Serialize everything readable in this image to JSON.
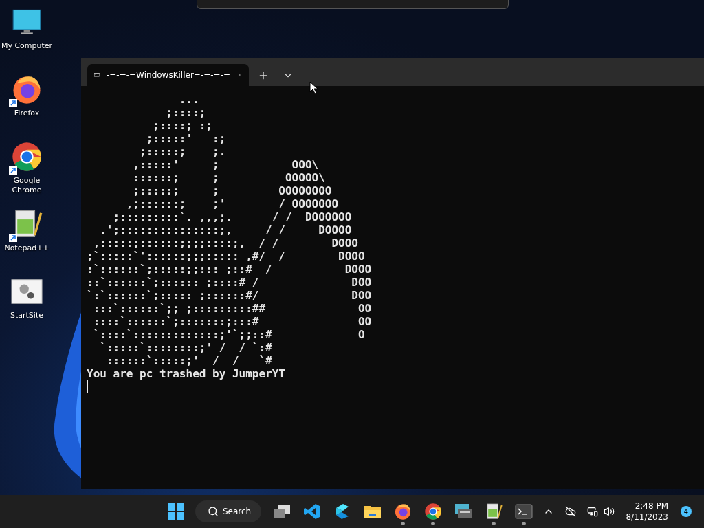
{
  "desktop_icons": [
    {
      "label": "My Computer",
      "kind": "monitor",
      "shortcut": false
    },
    {
      "label": "Firefox",
      "kind": "firefox",
      "shortcut": true
    },
    {
      "label": "Google Chrome",
      "kind": "chrome",
      "shortcut": true
    },
    {
      "label": "Notepad++",
      "kind": "notepad",
      "shortcut": true
    },
    {
      "label": "StartSite",
      "kind": "gears",
      "shortcut": false
    }
  ],
  "terminal": {
    "tabs": [
      {
        "title": "-=-=-=WindowsKiller=-=-=-=",
        "selected": true
      }
    ],
    "lines": [
      "              ...",
      "            ;::::;",
      "          ;::::; :;",
      "         ;:::::'   :;",
      "        ;:::::;    ;.",
      "       ,:::::'     ;           OOO\\",
      "       ::::::;     ;          OOOOO\\",
      "       ;:::::;     ;         OOOOOOOO",
      "      ,;::::::;    ;'        / OOOOOOO",
      "    ;:::::::::`. ,,,;.      / /  DOOOOOO",
      "  .';:::::::::::::::;,     / /     DOOOO",
      " ,:::::;::::::;;;;::::;,  / /        DOOO",
      ";`:::::`'::::::;;;::::: ,#/  /        DOOO",
      ":`::::::`;:::::;;::: ;::#  /           DOOO",
      "::`::::::`;:::::: ;::::# /              DOO",
      "`:`::::::`;::::: ;::::::#/              DOO",
      " :::`::::::`;; ;:::::::::##              OO",
      " ::::`::::::`;:::::::;:::#               OO",
      " `::::`:::::::::::::;'`;;::#             O",
      "  `:::::`::::::::;' /  / `:#",
      "   ::::::`:::::;'  /  /   `#",
      "You are pc trashed by JumperYT"
    ]
  },
  "taskbar": {
    "search": {
      "placeholder": "Search"
    },
    "apps": [
      {
        "kind": "taskview",
        "running": false
      },
      {
        "kind": "vscode",
        "running": false
      },
      {
        "kind": "azure",
        "running": false
      },
      {
        "kind": "folder",
        "running": false
      },
      {
        "kind": "firefox",
        "running": true
      },
      {
        "kind": "chrome",
        "running": true
      },
      {
        "kind": "remote",
        "running": false
      },
      {
        "kind": "notepad",
        "running": true
      },
      {
        "kind": "terminal",
        "running": true
      }
    ],
    "time": "2:48 PM",
    "date": "8/11/2023",
    "notifications": "4"
  }
}
